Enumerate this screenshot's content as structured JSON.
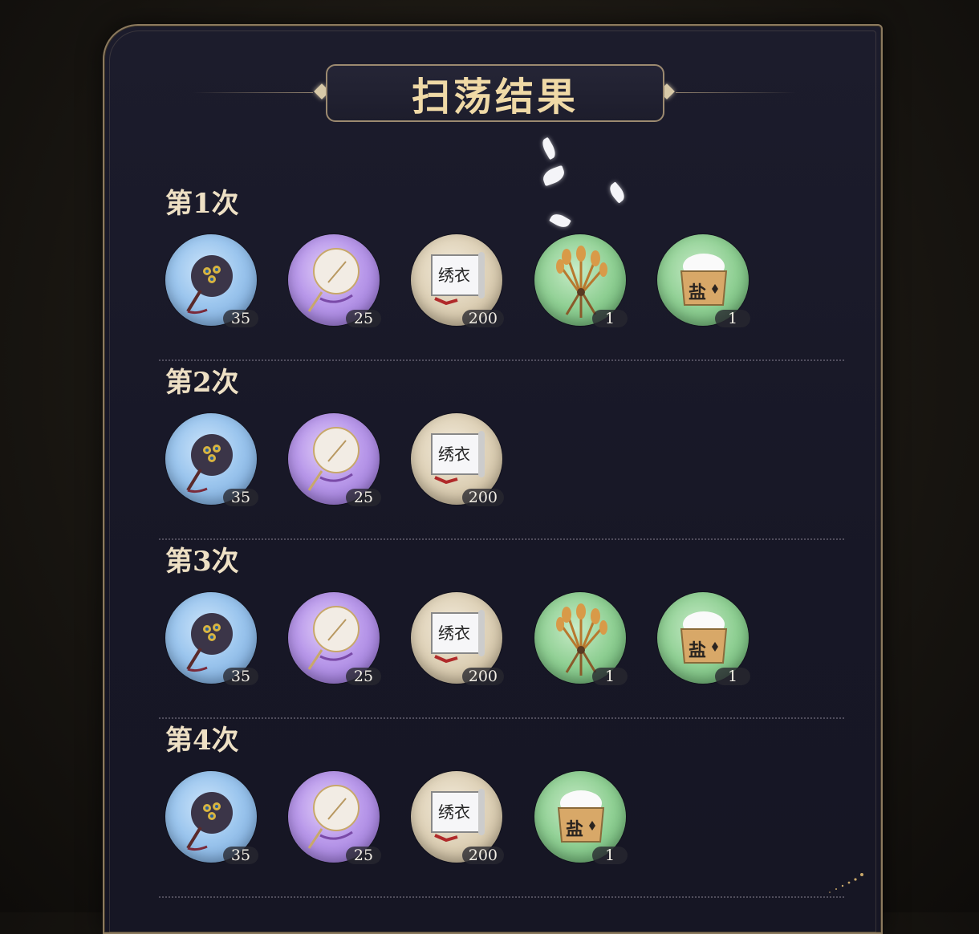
{
  "title": "扫荡结果",
  "rounds": [
    {
      "label": "第1次",
      "items": [
        {
          "name": "peacock-feather-fan",
          "color": "blue",
          "qty": "35"
        },
        {
          "name": "round-silk-fan",
          "color": "purple",
          "qty": "25"
        },
        {
          "name": "embroidery-scroll",
          "color": "beige",
          "qty": "200",
          "text": "绣衣"
        },
        {
          "name": "wheat-bundle",
          "color": "green",
          "qty": "1"
        },
        {
          "name": "salt-box",
          "color": "green",
          "qty": "1",
          "text": "盐"
        }
      ]
    },
    {
      "label": "第2次",
      "items": [
        {
          "name": "peacock-feather-fan",
          "color": "blue",
          "qty": "35"
        },
        {
          "name": "round-silk-fan",
          "color": "purple",
          "qty": "25"
        },
        {
          "name": "embroidery-scroll",
          "color": "beige",
          "qty": "200",
          "text": "绣衣"
        }
      ]
    },
    {
      "label": "第3次",
      "items": [
        {
          "name": "peacock-feather-fan",
          "color": "blue",
          "qty": "35"
        },
        {
          "name": "round-silk-fan",
          "color": "purple",
          "qty": "25"
        },
        {
          "name": "embroidery-scroll",
          "color": "beige",
          "qty": "200",
          "text": "绣衣"
        },
        {
          "name": "wheat-bundle",
          "color": "green",
          "qty": "1"
        },
        {
          "name": "salt-box",
          "color": "green",
          "qty": "1",
          "text": "盐"
        }
      ]
    },
    {
      "label": "第4次",
      "items": [
        {
          "name": "peacock-feather-fan",
          "color": "blue",
          "qty": "35"
        },
        {
          "name": "round-silk-fan",
          "color": "purple",
          "qty": "25"
        },
        {
          "name": "embroidery-scroll",
          "color": "beige",
          "qty": "200",
          "text": "绣衣"
        },
        {
          "name": "salt-box",
          "color": "green",
          "qty": "1",
          "text": "盐"
        }
      ]
    }
  ],
  "colors": {
    "panel_bg": "#1c1c2c",
    "panel_border": "#8c7a5e",
    "title_text": "#efd9a6",
    "label_text": "#eee0c4"
  }
}
